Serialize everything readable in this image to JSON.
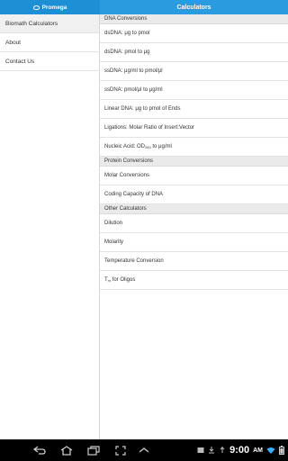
{
  "header": {
    "brand": "Promega",
    "title": "Calculators"
  },
  "sidebar": {
    "items": [
      {
        "label": "Biomath Calculators"
      },
      {
        "label": "About"
      },
      {
        "label": "Contact Us"
      }
    ]
  },
  "main": {
    "sections": [
      {
        "header": "DNA Conversions",
        "rows": [
          "dsDNA: μg to pmol",
          "dsDNA: pmol to μg",
          "ssDNA: μg/ml to pmol/μl",
          "ssDNA: pmol/μl to μg/ml",
          "Linear DNA: μg to pmol of Ends",
          "Ligations: Molar Ratio of Insert:Vector"
        ],
        "nucleic": {
          "prefix": "Nucleic Acid: OD",
          "sub": "260",
          "suffix": " to μg/ml"
        }
      },
      {
        "header": "Protein Conversions",
        "rows": [
          "Molar Conversions",
          "Coding Capacity of DNA"
        ]
      },
      {
        "header": "Other Calculators",
        "rows": [
          "Dilution",
          "Molarity",
          "Temperature Conversion"
        ],
        "tm": {
          "prefix": "T",
          "sub": "m",
          "suffix": " for Oligos"
        }
      }
    ]
  },
  "statusbar": {
    "time": "9:00",
    "ampm": "AM"
  },
  "colors": {
    "left_bar": "#1d8fd4",
    "right_bar": "#2b9be0"
  }
}
